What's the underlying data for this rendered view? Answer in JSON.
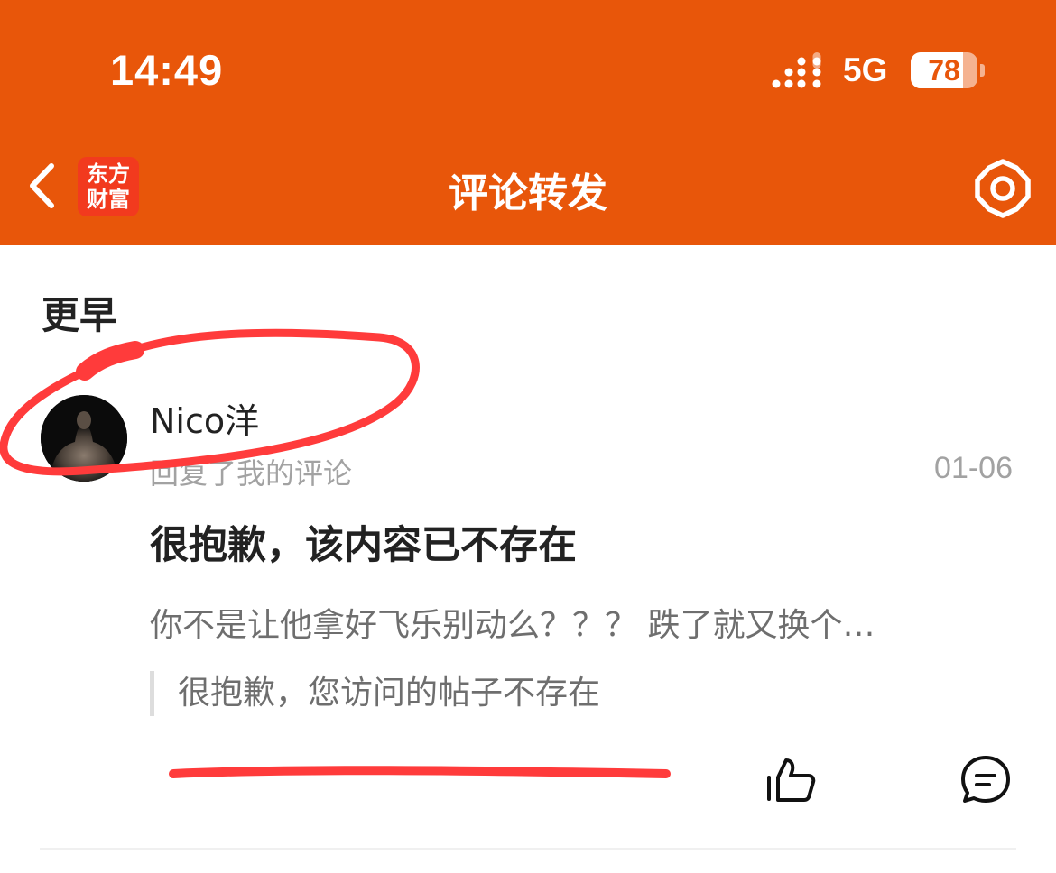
{
  "status_bar": {
    "time": "14:49",
    "network": "5G",
    "battery_level": "78",
    "battery_fraction": 0.78
  },
  "nav": {
    "back_icon": "chevron-left-icon",
    "logo_line1": "东方",
    "logo_line2": "财富",
    "title": "评论转发",
    "settings_icon": "gear-icon"
  },
  "section": {
    "title": "更早"
  },
  "notification": {
    "username": "Nico洋",
    "action": "回复了我的评论",
    "date": "01-06",
    "headline": "很抱歉，该内容已不存在",
    "comment": "你不是让他拿好飞乐别动么？？？ 跌了就又换个…",
    "quoted": "很抱歉，您访问的帖子不存在",
    "like_icon": "thumbs-up-icon",
    "reply_icon": "comment-bubble-icon"
  },
  "colors": {
    "brand": "#E8560A",
    "annotation": "#FF3B3B"
  }
}
